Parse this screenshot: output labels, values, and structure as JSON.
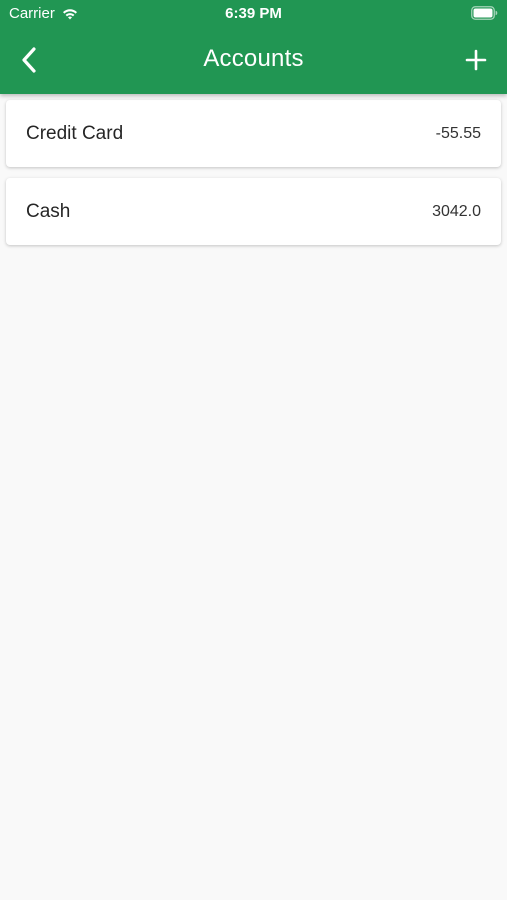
{
  "status_bar": {
    "carrier": "Carrier",
    "time": "6:39 PM"
  },
  "nav": {
    "title": "Accounts",
    "back_icon": "chevron-left-icon",
    "add_icon": "plus-icon"
  },
  "accounts": [
    {
      "name": "Credit Card",
      "amount": "-55.55"
    },
    {
      "name": "Cash",
      "amount": "3042.0"
    }
  ],
  "colors": {
    "header": "#219653",
    "background": "#f9f9f9",
    "card": "#ffffff"
  }
}
